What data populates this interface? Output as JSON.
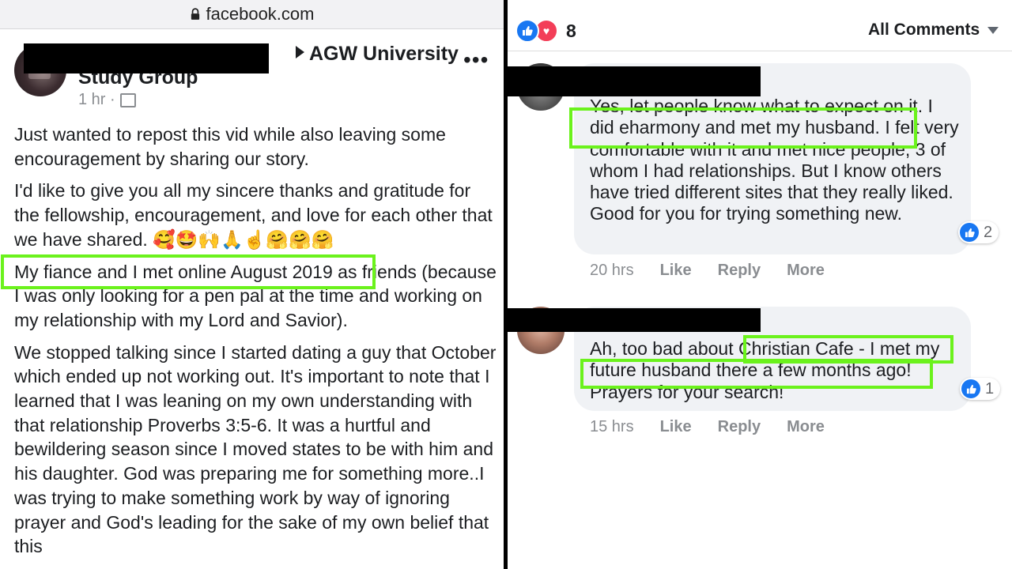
{
  "browser": {
    "url": "facebook.com"
  },
  "post": {
    "group_line1": "AGW University",
    "group_line2": "Study Group",
    "time": "1 hr ·",
    "more": "•••",
    "paragraphs": [
      "Just wanted to repost this vid while also leaving some encouragement by sharing our story.",
      "I'd like to give you all my sincere thanks and gratitude for the fellowship, encouragement, and love for each other that we have shared. 🥰🤩🙌🙏☝️🤗🤗🤗",
      "My fiance and I met online August 2019 as friends (because I was only looking for a pen pal at the time and working on my relationship with my Lord and Savior).",
      "We stopped talking since I started dating a guy that October which ended up not working out. It's important to note that I learned that I was leaning on my own understanding with that relationship Proverbs 3:5-6. It was a hurtful and bewildering season since I moved states to be with him and his daughter. God was preparing me for something more..I was trying to make something work by way of ignoring prayer and God's leading for the sake of my own belief that this"
    ]
  },
  "comments_header": {
    "reaction_count": "8",
    "filter_label": "All Comments"
  },
  "comments": [
    {
      "text": "Yes, let people know what to expect on it. I did eharmony and met my husband. I felt very comfortable with it and met nice people, 3 of whom I had relationships. But I know others have tried different sites that they really liked. Good for you for trying something new.",
      "reactions": "2",
      "time": "20 hrs",
      "like": "Like",
      "reply": "Reply",
      "more": "More"
    },
    {
      "text": "Ah, too bad about Christian Cafe - I met my future husband there a few months ago! Prayers for your search!",
      "reactions": "1",
      "time": "15 hrs",
      "like": "Like",
      "reply": "Reply",
      "more": "More"
    }
  ],
  "colors": {
    "highlight": "#6bf21c",
    "facebook_blue": "#1877f2",
    "love_red": "#f33e58"
  }
}
